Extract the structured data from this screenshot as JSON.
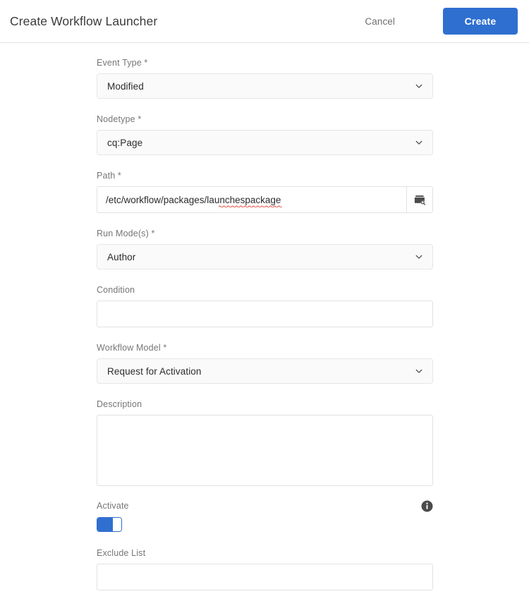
{
  "header": {
    "title": "Create Workflow Launcher",
    "cancel_label": "Cancel",
    "create_label": "Create",
    "accent_color": "#2f6fd0"
  },
  "form": {
    "event_type": {
      "label": "Event Type *",
      "value": "Modified",
      "icon": "chevron-down-icon"
    },
    "nodetype": {
      "label": "Nodetype *",
      "value": "cq:Page",
      "icon": "chevron-down-icon"
    },
    "path": {
      "label": "Path *",
      "value": "/etc/workflow/packages/launchespackage",
      "placeholder": "",
      "browse_icon": "folder-search-icon"
    },
    "run_modes": {
      "label": "Run Mode(s) *",
      "value": "Author",
      "icon": "chevron-down-icon"
    },
    "condition": {
      "label": "Condition",
      "value": "",
      "placeholder": ""
    },
    "workflow_model": {
      "label": "Workflow Model *",
      "value": "Request for Activation",
      "icon": "chevron-down-icon"
    },
    "description": {
      "label": "Description",
      "value": "",
      "placeholder": ""
    },
    "activate": {
      "label": "Activate",
      "info_icon": "info-icon",
      "state": "on",
      "toggle_color": "#2f6fd0"
    },
    "exclude_list": {
      "label": "Exclude List",
      "value": "",
      "placeholder": ""
    }
  }
}
